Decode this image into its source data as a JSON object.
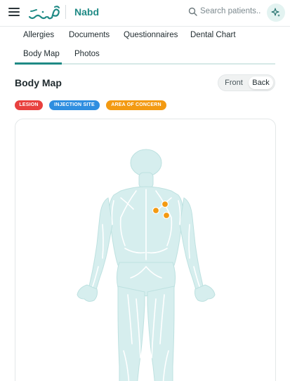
{
  "header": {
    "app_name": "Nabd",
    "search_placeholder": "Search patients...",
    "icons": {
      "menu": "hamburger-icon",
      "logo": "nabd-logo",
      "search": "search-icon",
      "ai": "sparkle-icon"
    },
    "accent_color": "#1f8a85"
  },
  "tabs": [
    {
      "label": "Allergies"
    },
    {
      "label": "Documents"
    },
    {
      "label": "Questionnaires"
    },
    {
      "label": "Dental Chart"
    },
    {
      "label": "Body Map",
      "active": true
    },
    {
      "label": "Photos"
    }
  ],
  "body_map": {
    "title": "Body Map",
    "view_options": [
      "Front",
      "Back"
    ],
    "selected_view": "Back",
    "legend": [
      {
        "label": "LESION",
        "color": "#e8413f"
      },
      {
        "label": "INJECTION SITE",
        "color": "#2f8ee0"
      },
      {
        "label": "AREA OF CONCERN",
        "color": "#f39a12"
      }
    ],
    "markers": [
      {
        "type": "AREA OF CONCERN",
        "region": "right shoulder blade"
      },
      {
        "type": "AREA OF CONCERN",
        "region": "right shoulder blade"
      },
      {
        "type": "AREA OF CONCERN",
        "region": "right shoulder blade"
      }
    ],
    "figure_color": "#d6eeee"
  }
}
